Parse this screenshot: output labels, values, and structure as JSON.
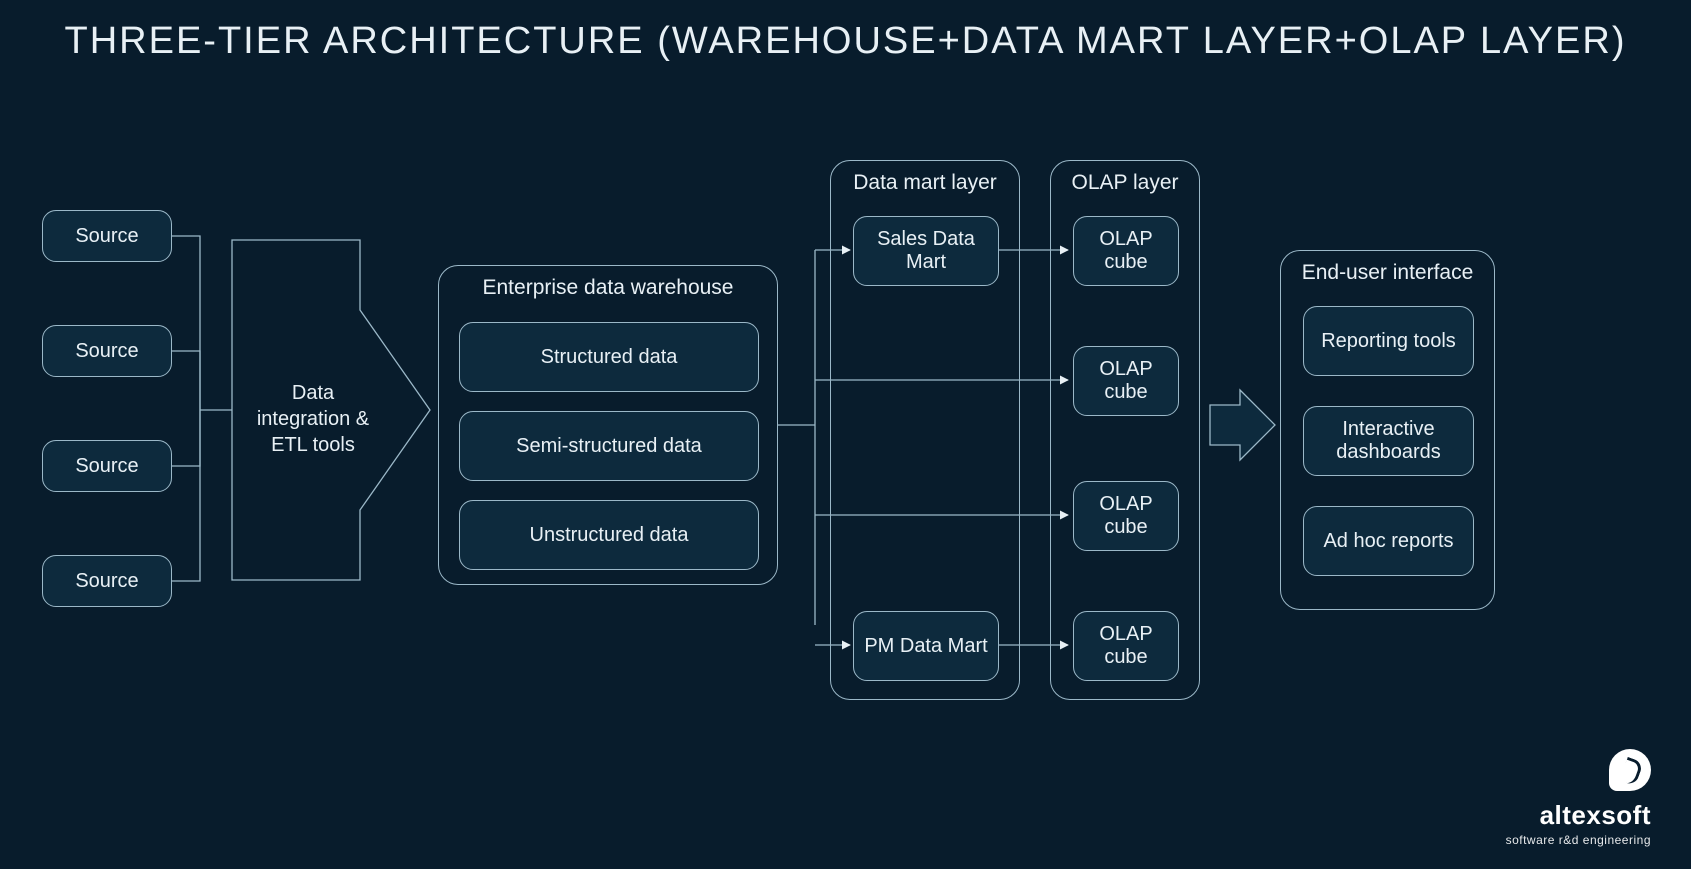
{
  "title": "THREE-TIER ARCHITECTURE (WAREHOUSE+DATA MART LAYER+OLAP LAYER)",
  "sources": [
    "Source",
    "Source",
    "Source",
    "Source"
  ],
  "etl_label": "Data integration & ETL tools",
  "warehouse": {
    "title": "Enterprise data warehouse",
    "items": [
      "Structured data",
      "Semi-structured data",
      "Unstructured data"
    ]
  },
  "data_mart": {
    "title": "Data mart layer",
    "items": [
      "Sales Data Mart",
      "PM Data Mart"
    ]
  },
  "olap": {
    "title": "OLAP layer",
    "items": [
      "OLAP cube",
      "OLAP cube",
      "OLAP cube",
      "OLAP cube"
    ]
  },
  "end_user": {
    "title": "End-user interface",
    "items": [
      "Reporting tools",
      "Interactive dashboards",
      "Ad hoc reports"
    ]
  },
  "brand": {
    "name": "altexsoft",
    "tagline": "software r&d engineering"
  }
}
